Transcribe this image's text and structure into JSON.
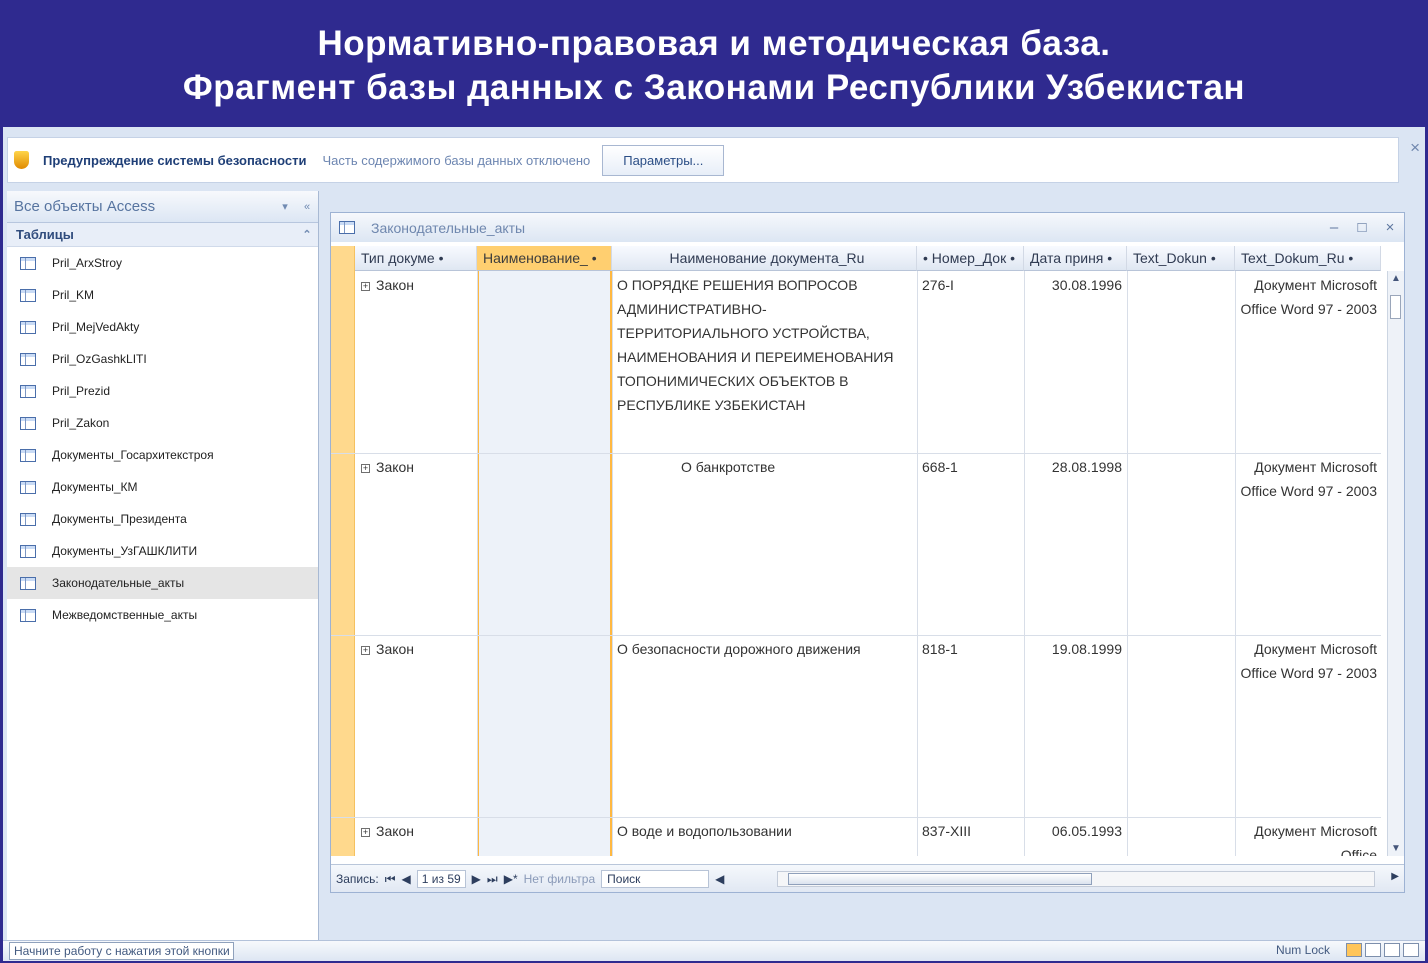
{
  "slide": {
    "title_line1": "Нормативно-правовая и методическая база.",
    "title_line2": "Фрагмент базы данных с Законами Республики Узбекистан"
  },
  "security_bar": {
    "warning": "Предупреждение системы безопасности",
    "message": "Часть содержимого базы данных отключено",
    "params_button": "Параметры...",
    "close_icon": "×"
  },
  "nav_pane": {
    "title": "Все объекты Access",
    "section": "Таблицы",
    "dropdown_icon": "▾",
    "collapse_icon": "«",
    "section_toggle_icon": "⌃",
    "items": [
      {
        "label": "Pril_ArxStroy"
      },
      {
        "label": "Pril_KM"
      },
      {
        "label": "Pril_MejVedAkty"
      },
      {
        "label": "Pril_OzGashkLITI"
      },
      {
        "label": "Pril_Prezid"
      },
      {
        "label": "Pril_Zakon"
      },
      {
        "label": "Документы_Госархитекстроя"
      },
      {
        "label": "Документы_КМ"
      },
      {
        "label": "Документы_Президента"
      },
      {
        "label": "Документы_УзГАШКЛИТИ"
      },
      {
        "label": "Законодательные_акты"
      },
      {
        "label": "Межведомственные_акты"
      }
    ],
    "selected_index": 10
  },
  "table_window": {
    "title": "Законодательные_акты",
    "minimize_icon": "–",
    "maximize_icon": "□",
    "close_icon": "×",
    "columns": [
      "Тип докуме •",
      "Наименование_ •",
      "Наименование документа_Ru",
      "• Номер_Док •",
      "Дата приня •",
      "Text_Dokun •",
      "Text_Dokum_Ru •"
    ],
    "rows": [
      {
        "type": "Закон",
        "name_ru": "О ПОРЯДКЕ РЕШЕНИЯ ВОПРОСОВ АДМИНИСТРАТИВНО-ТЕРРИТОРИАЛЬНОГО УСТРОЙСТВА, НАИМЕНОВАНИЯ И ПЕРЕИМЕНОВАНИЯ ТОПОНИМИЧЕСКИХ ОБЪЕКТОВ В РЕСПУБЛИКЕ УЗБЕКИСТАН",
        "number": "276-I",
        "date": "30.08.1996",
        "text_ru": "Документ Microsoft Office Word 97 - 2003"
      },
      {
        "type": "Закон",
        "name_ru": "О банкротстве",
        "number": "668-1",
        "date": "28.08.1998",
        "text_ru": "Документ Microsoft Office Word 97 - 2003"
      },
      {
        "type": "Закон",
        "name_ru": "О безопасности дорожного движения",
        "number": "818-1",
        "date": "19.08.1999",
        "text_ru": "Документ Microsoft Office Word 97 - 2003"
      },
      {
        "type": "Закон",
        "name_ru": "О воде и водопользовании",
        "number": "837-XIII",
        "date": "06.05.1993",
        "text_ru": "Документ Microsoft Office"
      }
    ],
    "record_nav": {
      "label": "Запись:",
      "position": "1 из 59",
      "no_filter": "Нет фильтра",
      "search": "Поиск"
    }
  },
  "status_bar": {
    "left": "Начните работу с нажатия этой кнопки",
    "num_lock": "Num Lock"
  }
}
